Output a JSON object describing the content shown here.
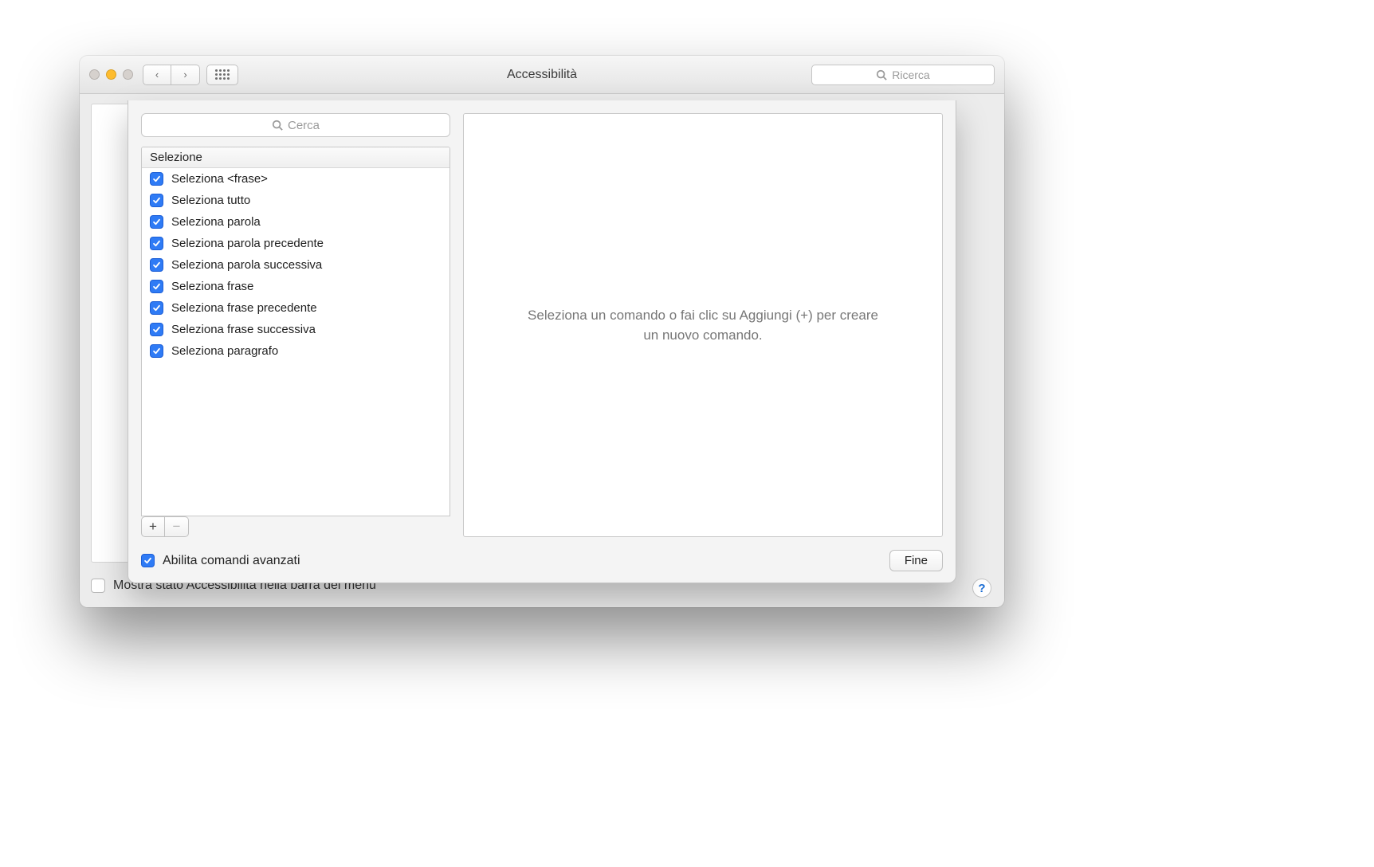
{
  "titlebar": {
    "title": "Accessibilità",
    "search_placeholder": "Ricerca"
  },
  "sheet": {
    "search_placeholder": "Cerca",
    "list_header": "Selezione",
    "items": [
      {
        "checked": true,
        "label": "Seleziona <frase>"
      },
      {
        "checked": true,
        "label": "Seleziona tutto"
      },
      {
        "checked": true,
        "label": "Seleziona parola"
      },
      {
        "checked": true,
        "label": "Seleziona parola precedente"
      },
      {
        "checked": true,
        "label": "Seleziona parola successiva"
      },
      {
        "checked": true,
        "label": "Seleziona frase"
      },
      {
        "checked": true,
        "label": "Seleziona frase precedente"
      },
      {
        "checked": true,
        "label": "Seleziona frase successiva"
      },
      {
        "checked": true,
        "label": "Seleziona paragrafo"
      }
    ],
    "add_label": "+",
    "remove_label": "−",
    "detail_hint": "Seleziona un comando o fai clic su Aggiungi (+) per creare un nuovo comando.",
    "advanced_checkbox_label": "Abilita comandi avanzati",
    "advanced_checkbox_checked": true,
    "done_label": "Fine"
  },
  "outer": {
    "menubar_checkbox_label": "Mostra stato Accessibilità nella barra dei menu",
    "menubar_checkbox_checked": false,
    "help_label": "?"
  }
}
